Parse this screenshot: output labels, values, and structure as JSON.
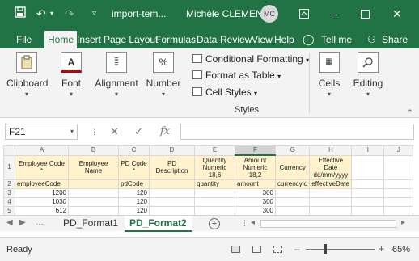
{
  "title_bar": {
    "filename": "import-tem...",
    "user_name": "Michèle CLEMENT",
    "user_initials": "MC"
  },
  "menu": {
    "tabs": [
      "File",
      "Home",
      "Insert",
      "Page Layout",
      "Formulas",
      "Data",
      "Review",
      "View",
      "Help"
    ],
    "active_tab": "Home",
    "tell_me": "Tell me",
    "share": "Share"
  },
  "ribbon": {
    "clipboard": "Clipboard",
    "font": "Font",
    "alignment": "Alignment",
    "number": "Number",
    "conditional_formatting": "Conditional Formatting",
    "format_as_table": "Format as Table",
    "cell_styles": "Cell Styles",
    "styles_group": "Styles",
    "cells": "Cells",
    "editing": "Editing"
  },
  "formula_bar": {
    "name_box": "F21",
    "formula": ""
  },
  "grid": {
    "columns": [
      "A",
      "B",
      "C",
      "D",
      "E",
      "F",
      "G",
      "H",
      "I",
      "J"
    ],
    "selected_column": "F",
    "row_numbers": [
      "1",
      "2",
      "3",
      "4",
      "5",
      "6"
    ],
    "header_row": [
      "Employee Code *",
      "Employee Name",
      "PD Code *",
      "PD Description",
      "Quantity Numeric 18,6",
      "Amount Numeric 18,2",
      "Currency",
      "Effective Date dd/mm/yyyy",
      "",
      ""
    ],
    "field_row": [
      "employeeCode",
      "",
      "pdCode",
      "",
      "quantity",
      "amount",
      "currencyId",
      "effectiveDate",
      "",
      ""
    ],
    "data_rows": [
      [
        "1200",
        "",
        "120",
        "",
        "",
        "300",
        "",
        "",
        "",
        ""
      ],
      [
        "1030",
        "",
        "120",
        "",
        "",
        "300",
        "",
        "",
        "",
        ""
      ],
      [
        "612",
        "",
        "120",
        "",
        "",
        "300",
        "",
        "",
        "",
        ""
      ],
      [
        "",
        "",
        "",
        "",
        "",
        "",
        "",
        "",
        "",
        ""
      ]
    ]
  },
  "sheets": {
    "tabs": [
      "PD_Format1",
      "PD_Format2"
    ],
    "active": "PD_Format2"
  },
  "status_bar": {
    "status": "Ready",
    "zoom": "65%"
  },
  "colors": {
    "excel_green": "#217346",
    "header_fill": "#fff2cc"
  }
}
